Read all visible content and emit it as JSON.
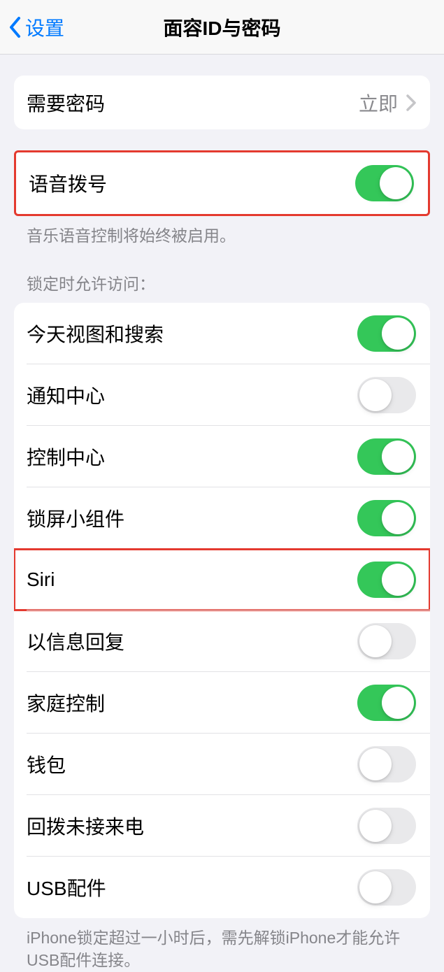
{
  "nav": {
    "back_label": "设置",
    "title": "面容ID与密码"
  },
  "require_passcode": {
    "label": "需要密码",
    "value": "立即"
  },
  "voice_dial": {
    "label": "语音拨号",
    "on": true,
    "footer": "音乐语音控制将始终被启用。"
  },
  "lock_access": {
    "header": "锁定时允许访问：",
    "items": [
      {
        "label": "今天视图和搜索",
        "on": true
      },
      {
        "label": "通知中心",
        "on": false
      },
      {
        "label": "控制中心",
        "on": true
      },
      {
        "label": "锁屏小组件",
        "on": true
      },
      {
        "label": "Siri",
        "on": true,
        "highlighted": true
      },
      {
        "label": "以信息回复",
        "on": false
      },
      {
        "label": "家庭控制",
        "on": true
      },
      {
        "label": "钱包",
        "on": false
      },
      {
        "label": "回拨未接来电",
        "on": false
      },
      {
        "label": "USB配件",
        "on": false
      }
    ],
    "footer": "iPhone锁定超过一小时后，需先解锁iPhone才能允许USB配件连接。"
  }
}
